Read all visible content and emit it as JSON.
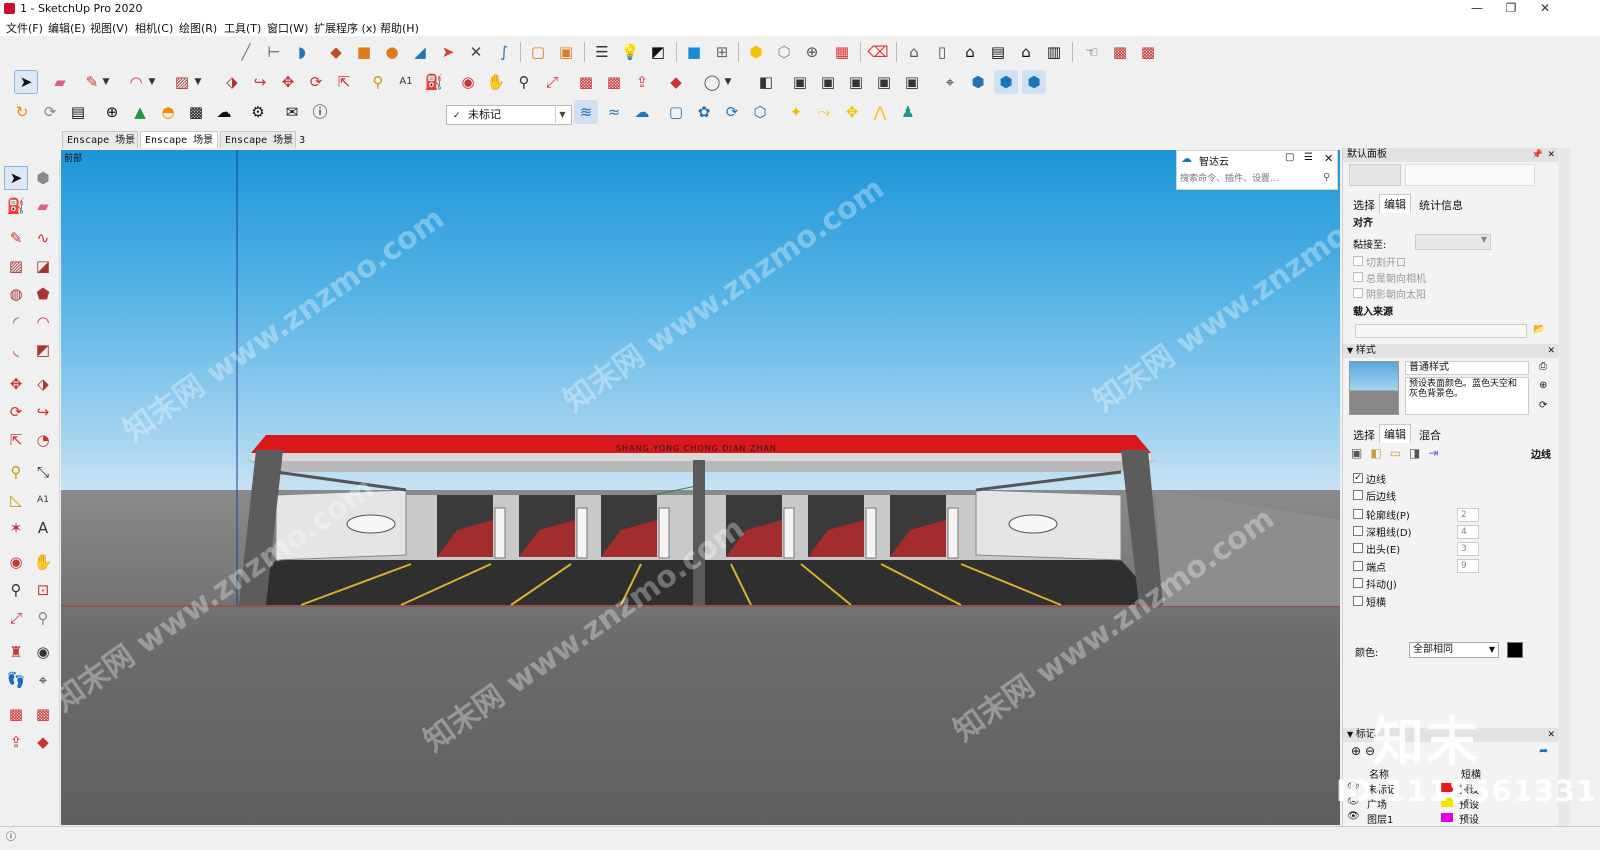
{
  "window": {
    "title": "1 - SketchUp Pro 2020",
    "controls": [
      "—",
      "❐",
      "✕"
    ]
  },
  "menu": [
    "文件(F)",
    "编辑(E)",
    "视图(V)",
    "相机(C)",
    "绘图(R)",
    "工具(T)",
    "窗口(W)",
    "扩展程序 (x)",
    "帮助(H)"
  ],
  "toolbar": {
    "tag_select_value": "未标记",
    "scene_tabs": [
      "Enscape 场景 1",
      "Enscape 场景 2",
      "Enscape 场景 3"
    ],
    "active_scene_index": 1
  },
  "viewport": {
    "label": "前部",
    "sign_text": "SHANG YONG CHONG DIAN ZHAN",
    "watermark": "知末网 www.znzmo.com"
  },
  "search_panel": {
    "title": "智达云",
    "placeholder": "搜索命令、插件、设置..."
  },
  "right_panel": {
    "header": "默认面板",
    "entity_tabs": [
      "选择",
      "编辑",
      "统计信息"
    ],
    "align_heading": "对齐",
    "glue_label": "黏接至:",
    "align_options": [
      "切割开口",
      "总是朝向相机",
      "阴影朝向太阳"
    ],
    "load_source": "载入来源",
    "styles": {
      "header": "样式",
      "style_name": "普通样式",
      "style_desc": "预设表面颜色。蓝色天空和灰色背景色。",
      "tabs": [
        "选择",
        "编辑",
        "混合"
      ],
      "edge_label": "边线",
      "edge_options": [
        {
          "label": "边线",
          "checked": true,
          "value": ""
        },
        {
          "label": "后边线",
          "checked": false,
          "value": ""
        },
        {
          "label": "轮廓线(P)",
          "checked": false,
          "value": "2"
        },
        {
          "label": "深粗线(D)",
          "checked": false,
          "value": "4"
        },
        {
          "label": "出头(E)",
          "checked": false,
          "value": "3"
        },
        {
          "label": "端点",
          "checked": false,
          "value": "9"
        },
        {
          "label": "抖动(J)",
          "checked": false,
          "value": ""
        },
        {
          "label": "短横",
          "checked": false,
          "value": ""
        }
      ],
      "color_label": "颜色:",
      "color_value": "全部相同"
    },
    "tags": {
      "header": "标记",
      "col_name": "名称",
      "col_dash": "短横",
      "rows": [
        {
          "name": "未标记",
          "dash": "预设",
          "color": "#e31b1b"
        },
        {
          "name": "广场",
          "dash": "预设",
          "color": "#f2e600"
        },
        {
          "name": "图层1",
          "dash": "预设",
          "color": "#e600e6"
        }
      ]
    }
  },
  "overlay": {
    "brand": "知末",
    "id_text": "ID:1118561331"
  },
  "statusbar": {
    "text": ""
  },
  "colors": {
    "accent_red": "#d7191c",
    "sky_top": "#1c95d9",
    "ground": "#6c6c6c"
  }
}
